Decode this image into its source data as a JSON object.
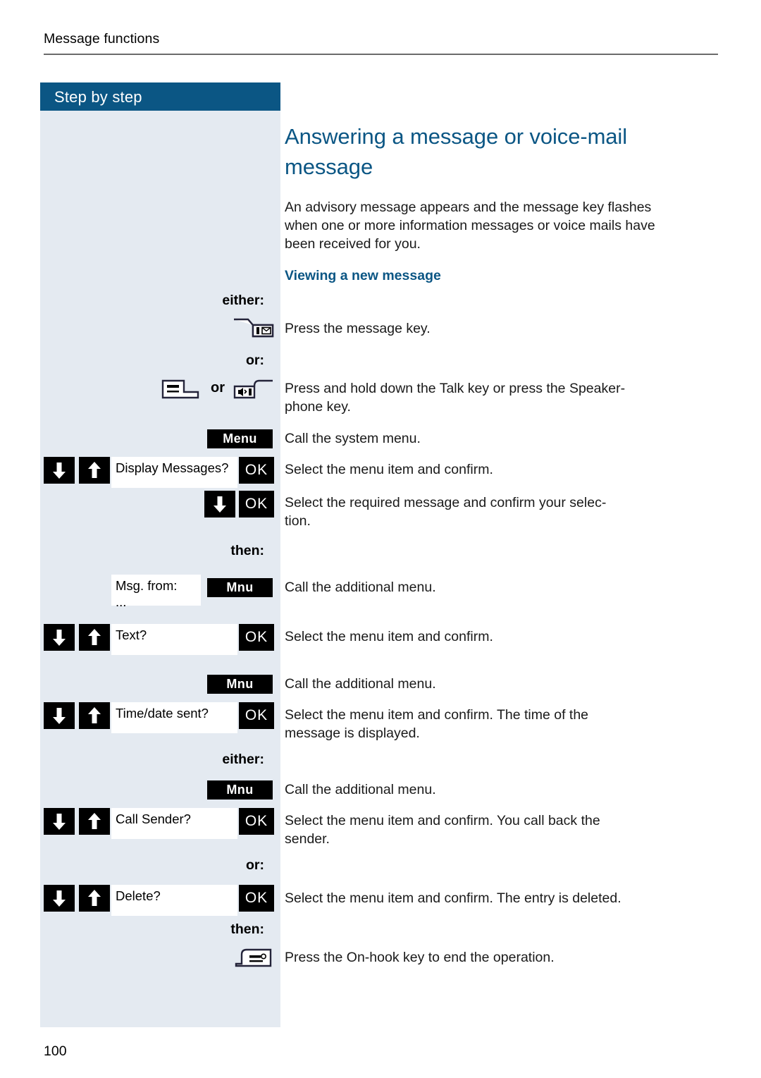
{
  "page": {
    "running_head": "Message functions",
    "folio": "100",
    "accent_color": "#0b5684",
    "panel_color": "#e4eaf1"
  },
  "sidebar": {
    "header_label": "Step by step"
  },
  "content": {
    "title": "Answering a message or voice-mail message",
    "intro": "An advisory message appears and the message key flashes when one or more information messages or voice mails have been received for you.",
    "subhead": "Viewing a new message"
  },
  "keywords": {
    "either_1": "either:",
    "or_1": "or:",
    "then_1": "then:",
    "either_2": "either:",
    "or_2": "or:",
    "then_2": "then:",
    "inline_or": "or"
  },
  "softkeys": {
    "menu": "Menu",
    "mnu_1": "Mnu",
    "mnu_2": "Mnu",
    "mnu_3": "Mnu",
    "ok_1": "OK",
    "ok_2": "OK",
    "ok_3": "OK",
    "ok_4": "OK",
    "ok_5": "OK",
    "ok_6": "OK"
  },
  "display_fields": {
    "display_messages": "Display Messages?",
    "msg_from_line1": "Msg. from:",
    "msg_from_line2": "...",
    "text": "Text?",
    "time_date_sent": "Time/date sent?",
    "call_sender": "Call Sender?",
    "delete": "Delete?"
  },
  "icons": {
    "message_key": "message-key-icon",
    "talk_key": "talk-key-icon",
    "speaker_key": "speakerphone-key-icon",
    "onhook_key": "on-hook-key-icon",
    "arrow_down": "arrow-down-icon",
    "arrow_up": "arrow-up-icon"
  },
  "instructions": {
    "press_message_key": "Press the message key.",
    "press_talk_speaker": "Press and hold down the Talk key or press the Speaker-phone key.",
    "call_system_menu": "Call the system menu.",
    "select_confirm_1": "Select the menu item and confirm.",
    "select_required_message": "Select the required message and confirm your selec-tion.",
    "call_additional_menu_1": "Call the additional menu.",
    "select_confirm_2": "Select the menu item and confirm.",
    "call_additional_menu_2": "Call the additional menu.",
    "select_confirm_time": "Select the menu item and confirm. The time of the message is displayed.",
    "call_additional_menu_3": "Call the additional menu.",
    "select_confirm_callback": "Select the menu item and confirm. You call back the sender.",
    "select_confirm_delete": "Select the menu item and confirm. The entry is deleted.",
    "press_onhook": "Press the On-hook key to end the operation."
  }
}
